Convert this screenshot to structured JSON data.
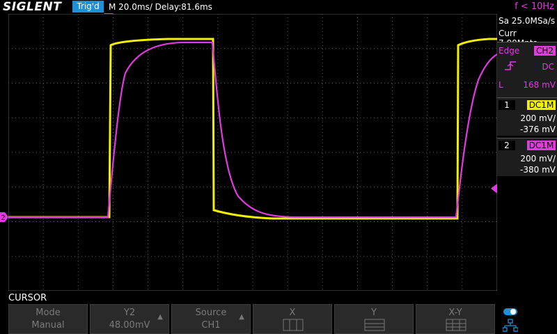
{
  "header": {
    "brand": "SIGLENT",
    "trigger_status": "Trig'd",
    "timebase": "M 20.0ms/ Delay:81.6ms",
    "frequency": "f < 10Hz"
  },
  "acquisition": {
    "sample_rate": "Sa 25.0MSa/s",
    "memory_depth": "Curr 7.00Mpts"
  },
  "trigger": {
    "type": "Edge",
    "source": "CH2",
    "coupling": "DC",
    "level_label": "L",
    "level": "168 mV"
  },
  "channels": [
    {
      "number": "1",
      "coupling": "DC1M",
      "scale": "200 mV/",
      "offset": "-376 mV",
      "color": "#f0f000"
    },
    {
      "number": "2",
      "coupling": "DC1M",
      "scale": "200 mV/",
      "offset": "-380 mV",
      "color": "#e13ae1"
    }
  ],
  "ch2_marker_label": "2",
  "menu": {
    "title": "CURSOR",
    "softkeys": [
      {
        "label": "Mode",
        "value": "Manual"
      },
      {
        "label": "Y2",
        "value": "48.00mV"
      },
      {
        "label": "Source",
        "value": "CH1"
      },
      {
        "label": "X",
        "value": ""
      },
      {
        "label": "Y",
        "value": ""
      },
      {
        "label": "X-Y",
        "value": ""
      }
    ]
  },
  "colors": {
    "ch1": "#f0f000",
    "ch2": "#e13ae1",
    "accent": "#1e90d8",
    "grid": "#5a5a5a"
  }
}
